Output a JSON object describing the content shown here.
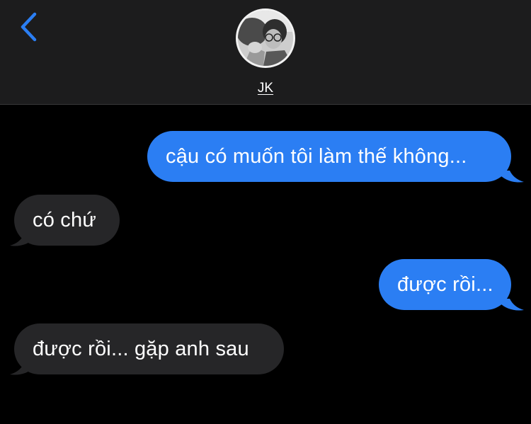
{
  "header": {
    "back_icon": "chevron-left-icon",
    "contact_name": "JK",
    "avatar": "profile-photo"
  },
  "messages": [
    {
      "direction": "sent",
      "text": "cậu có muốn tôi làm thế không..."
    },
    {
      "direction": "received",
      "text": "có chứ"
    },
    {
      "direction": "sent",
      "text": "được rồi..."
    },
    {
      "direction": "received",
      "text": "được rồi... gặp anh sau"
    }
  ],
  "colors": {
    "sent_bubble": "#2b7ef3",
    "received_bubble": "#262628",
    "header_bg": "#1c1c1d",
    "accent": "#2b7ef3"
  }
}
